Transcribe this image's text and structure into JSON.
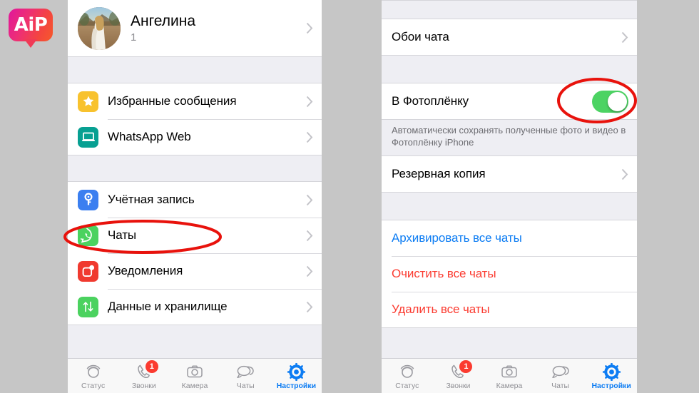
{
  "watermark": {
    "text": "AiP"
  },
  "colors": {
    "accent_blue": "#0c7cf3",
    "destructive_red": "#fb3b30",
    "toggle_on_green": "#4cd363",
    "annotation_red": "#e8120c",
    "page_background": "#c6c6c6",
    "group_background": "#ffffff",
    "gap_background": "#eeeef3"
  },
  "left_screen": {
    "profile": {
      "name": "Ангелина",
      "status": "1",
      "avatar_icon": "user-photo-avatar",
      "chevron_icon": "chevron-right-icon"
    },
    "group_one": [
      {
        "label": "Избранные сообщения",
        "icon": "star-icon",
        "icon_color": "#f8c22e",
        "chevron_icon": "chevron-right-icon"
      },
      {
        "label": "WhatsApp Web",
        "icon": "laptop-icon",
        "icon_color": "#07a092",
        "chevron_icon": "chevron-right-icon"
      }
    ],
    "group_two": [
      {
        "label": "Учётная запись",
        "icon": "key-icon",
        "icon_color": "#3b7ff0",
        "chevron_icon": "chevron-right-icon"
      },
      {
        "label": "Чаты",
        "icon": "whatsapp-chat-icon",
        "icon_color": "#4bd25f",
        "chevron_icon": "chevron-right-icon",
        "highlighted": true
      },
      {
        "label": "Уведомления",
        "icon": "notification-icon",
        "icon_color": "#f03a2f",
        "chevron_icon": "chevron-right-icon"
      },
      {
        "label": "Данные и хранилище",
        "icon": "arrows-updown-icon",
        "icon_color": "#4bd25f",
        "chevron_icon": "chevron-right-icon"
      }
    ],
    "tabbar": [
      {
        "label": "Статус",
        "icon": "status-rings-icon",
        "active": false,
        "badge": null
      },
      {
        "label": "Звонки",
        "icon": "phone-icon",
        "active": false,
        "badge": "1"
      },
      {
        "label": "Камера",
        "icon": "camera-icon",
        "active": false,
        "badge": null
      },
      {
        "label": "Чаты",
        "icon": "chat-bubbles-icon",
        "active": false,
        "badge": null
      },
      {
        "label": "Настройки",
        "icon": "gear-icon",
        "active": true,
        "badge": null
      }
    ]
  },
  "right_screen": {
    "wallpaper_row": {
      "label": "Обои чата",
      "chevron_icon": "chevron-right-icon"
    },
    "camera_roll_row": {
      "label": "В Фотоплёнку",
      "toggle_state": "on",
      "toggle_icon": "toggle-switch-icon",
      "highlighted": true
    },
    "camera_roll_footnote": "Автоматически сохранять полученные фото и видео в Фотоплёнку iPhone",
    "backup_row": {
      "label": "Резервная копия",
      "chevron_icon": "chevron-right-icon"
    },
    "actions": [
      {
        "label": "Архивировать все чаты",
        "style": "blue"
      },
      {
        "label": "Очистить все чаты",
        "style": "red"
      },
      {
        "label": "Удалить все чаты",
        "style": "red"
      }
    ],
    "tabbar": [
      {
        "label": "Статус",
        "icon": "status-rings-icon",
        "active": false,
        "badge": null
      },
      {
        "label": "Звонки",
        "icon": "phone-icon",
        "active": false,
        "badge": "1"
      },
      {
        "label": "Камера",
        "icon": "camera-icon",
        "active": false,
        "badge": null
      },
      {
        "label": "Чаты",
        "icon": "chat-bubbles-icon",
        "active": false,
        "badge": null
      },
      {
        "label": "Настройки",
        "icon": "gear-icon",
        "active": true,
        "badge": null
      }
    ]
  },
  "annotations": [
    {
      "name": "chats-row-highlight",
      "shape": "ellipse",
      "color": "#e8120c"
    },
    {
      "name": "camera-roll-toggle-highlight",
      "shape": "ellipse",
      "color": "#e8120c"
    }
  ]
}
